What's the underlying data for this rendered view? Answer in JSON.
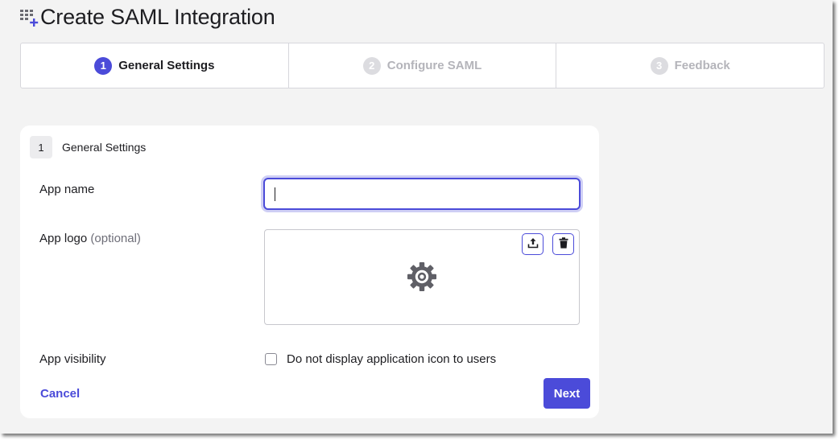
{
  "page": {
    "title": "Create SAML Integration",
    "title_icon": "grid-plus-icon"
  },
  "stepper": {
    "steps": [
      {
        "number": "1",
        "label": "General Settings",
        "state": "active"
      },
      {
        "number": "2",
        "label": "Configure SAML",
        "state": "inactive"
      },
      {
        "number": "3",
        "label": "Feedback",
        "state": "inactive"
      }
    ]
  },
  "section": {
    "number": "1",
    "title": "General Settings"
  },
  "form": {
    "app_name_label": "App name",
    "app_name_value": "",
    "app_logo_label": "App logo",
    "app_logo_optional": "(optional)",
    "app_logo_placeholder_icon": "gear-icon",
    "upload_icon": "upload-icon",
    "delete_icon": "trash-icon",
    "app_visibility_label": "App visibility",
    "visibility_checkbox_label": "Do not display application icon to users",
    "visibility_checked": false
  },
  "actions": {
    "cancel_label": "Cancel",
    "next_label": "Next"
  },
  "colors": {
    "accent": "#4b4bd9",
    "background": "#f3f3f3",
    "inactive_text": "#b4b4ba"
  }
}
